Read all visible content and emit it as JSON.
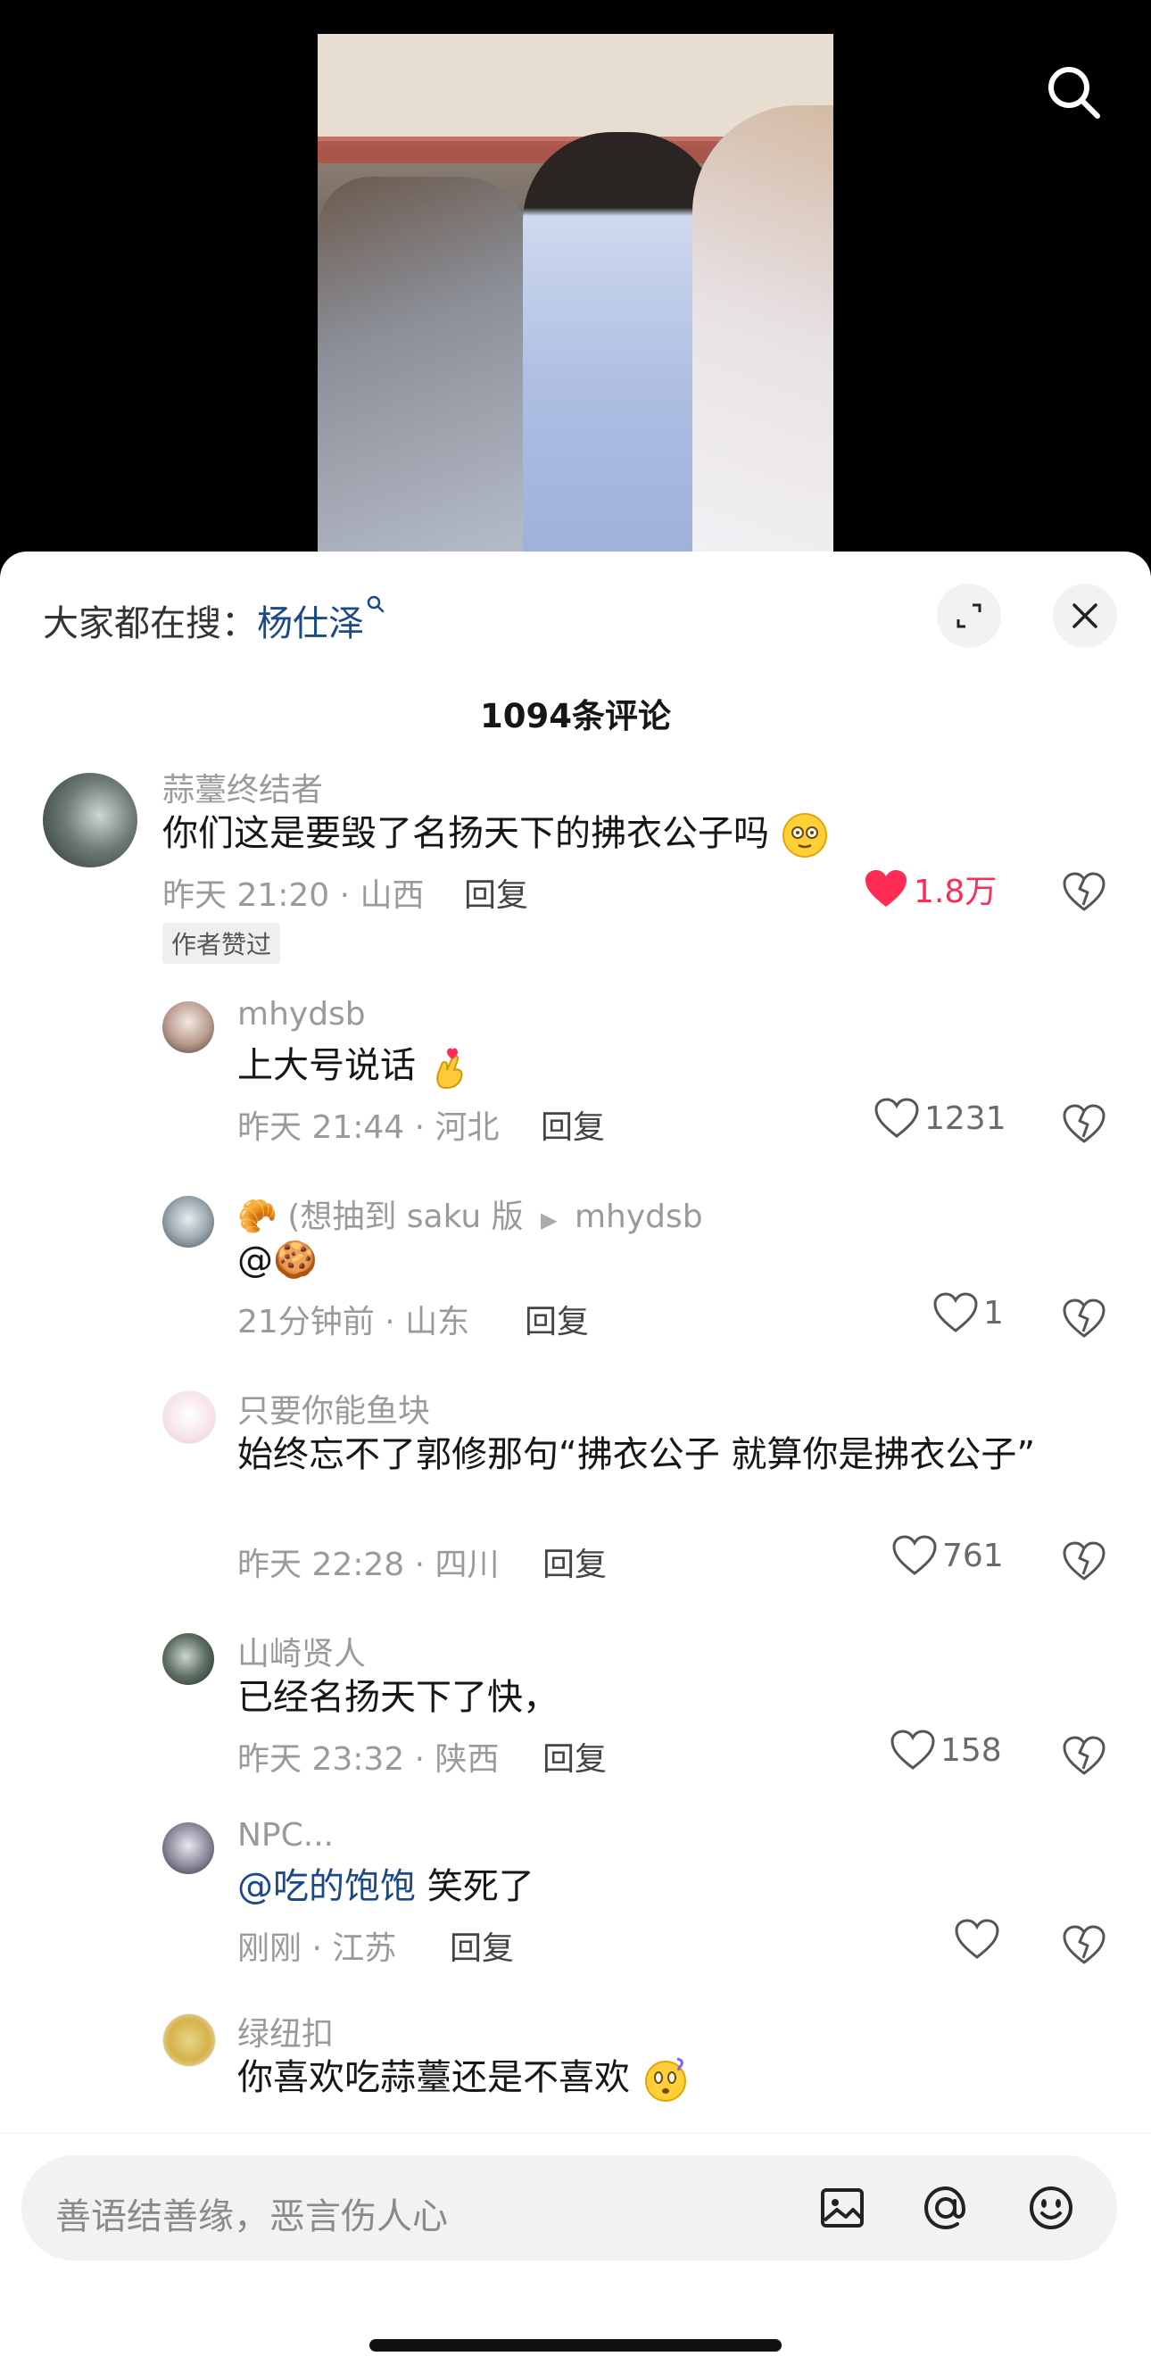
{
  "hot_search": {
    "prefix": "大家都在搜：",
    "keyword": "杨仕泽"
  },
  "comment_count": "1094条评论",
  "comments": [
    {
      "user": "蒜薹终结者",
      "text": "你们这是要毁了名扬天下的拂衣公子吗",
      "time_loc": "昨天 21:20 · 山西",
      "reply": "回复",
      "likes": "1.8万",
      "liked": true,
      "badge": "作者赞过"
    },
    {
      "user": "mhydsb",
      "text": "上大号说话",
      "time_loc": "昨天 21:44 · 河北",
      "reply": "回复",
      "likes": "1231"
    },
    {
      "user": "🥐 (想抽到 saku 版",
      "reply_to": "mhydsb",
      "text": "@🍪",
      "time_loc": "21分钟前 · 山东",
      "reply": "回复",
      "likes": "1"
    },
    {
      "user": "只要你能鱼块",
      "text": "始终忘不了郭修那句“拂衣公子  就算你是拂衣公子”",
      "time_loc": "昨天 22:28 · 四川",
      "reply": "回复",
      "likes": "761"
    },
    {
      "user": "山崎贤人",
      "text": "已经名扬天下了快，",
      "time_loc": "昨天 23:32 · 陕西",
      "reply": "回复",
      "likes": "158"
    },
    {
      "user": "NPC...",
      "mention": "@吃的饱饱",
      "text": " 笑死了",
      "time_loc": "刚刚 · 江苏",
      "reply": "回复",
      "likes": ""
    },
    {
      "user": "绿纽扣",
      "text": "你喜欢吃蒜薹还是不喜欢"
    }
  ],
  "input": {
    "placeholder": "善语结善缘，恶言伤人心"
  },
  "colors": {
    "accent_red": "#fe2c55",
    "link_blue": "#1a4a8a"
  }
}
